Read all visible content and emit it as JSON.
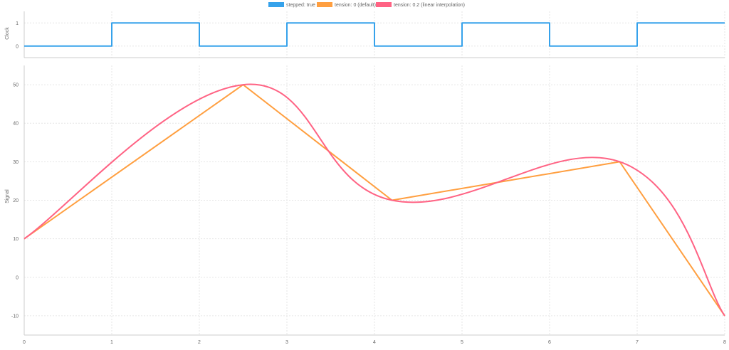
{
  "chart_data": [
    {
      "type": "line",
      "name": "clock",
      "ylabel": "Clock",
      "ylim": [
        0,
        1
      ],
      "yticks": [
        "0",
        "1"
      ],
      "xlim": [
        0,
        8
      ],
      "xticks": [
        "0",
        "1",
        "2",
        "3",
        "4",
        "5",
        "6",
        "7",
        "8"
      ],
      "grid": true,
      "series": [
        {
          "name": "stepped: true",
          "color": "#36a2eb",
          "stepped": true,
          "x": [
            0,
            1,
            2,
            3,
            4,
            5,
            6,
            7,
            8
          ],
          "y": [
            0,
            1,
            0,
            1,
            0,
            1,
            0,
            1,
            1
          ]
        }
      ]
    },
    {
      "type": "line",
      "name": "signal",
      "ylabel": "Signal",
      "ylim": [
        -15,
        55
      ],
      "yticks": [
        "-10",
        "0",
        "10",
        "20",
        "30",
        "40",
        "50"
      ],
      "xlim": [
        0,
        8
      ],
      "xticks": [
        "0",
        "1",
        "2",
        "3",
        "4",
        "5",
        "6",
        "7",
        "8"
      ],
      "grid": true,
      "series": [
        {
          "name": "tension: 0 (default)",
          "color": "#ff9f40",
          "x": [
            0,
            2.5,
            4.2,
            6.8,
            8
          ],
          "y": [
            10,
            50,
            20,
            30,
            -10
          ]
        },
        {
          "name": "tension: 0.2 (linear interpolation)",
          "color": "#ff6384",
          "smooth": true,
          "x": [
            0,
            2.5,
            4.2,
            6.8,
            8
          ],
          "y": [
            10,
            50,
            20,
            30,
            -10
          ]
        }
      ]
    }
  ],
  "legend": {
    "placement": "top",
    "items": [
      {
        "label": "stepped: true",
        "color": "#36a2eb"
      },
      {
        "label": "tension: 0 (default)",
        "color": "#ff9f40"
      },
      {
        "label": "tension: 0.2 (linear interpolation)",
        "color": "#ff6384"
      }
    ]
  }
}
